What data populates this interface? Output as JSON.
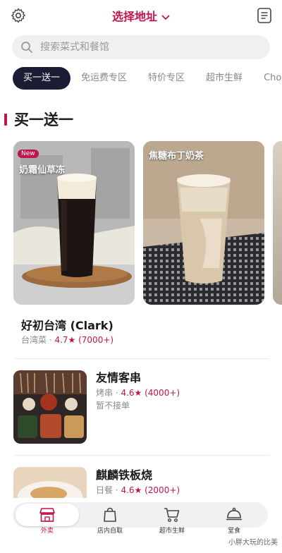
{
  "header": {
    "address_label": "选择地址"
  },
  "search": {
    "placeholder": "搜索菜式和餐馆"
  },
  "chips": [
    "买一送一",
    "免运费专区",
    "特价专区",
    "超市生鲜",
    "Cho"
  ],
  "section": {
    "title": "买一送一"
  },
  "featured": {
    "cards": [
      {
        "badge": "New",
        "label": "奶霜仙草冻"
      },
      {
        "label": "焦糖布丁奶茶"
      }
    ],
    "restaurant_name": "好初台湾 (Clark)",
    "cuisine": "台湾菜 · ",
    "rating": "4.7★ (7000+)"
  },
  "restaurants": [
    {
      "name": "友情客串",
      "cuisine": "烤串 · ",
      "rating": "4.6★ (4000+)",
      "status": "暂不接单"
    },
    {
      "name": "麒麟铁板烧",
      "cuisine": "日餐 · ",
      "rating": "4.6★ (2000+)"
    }
  ],
  "tabbar": {
    "items": [
      {
        "label": "外卖",
        "icon": "storefront-icon"
      },
      {
        "label": "店内自取",
        "icon": "shopping-bag-icon"
      },
      {
        "label": "超市生鲜",
        "icon": "cart-icon"
      },
      {
        "label": "堂食",
        "icon": "cloche-icon"
      }
    ]
  },
  "watermark": "小胖大玩的比美",
  "colors": {
    "accent": "#c0144f",
    "chip_active": "#1c1c34"
  }
}
